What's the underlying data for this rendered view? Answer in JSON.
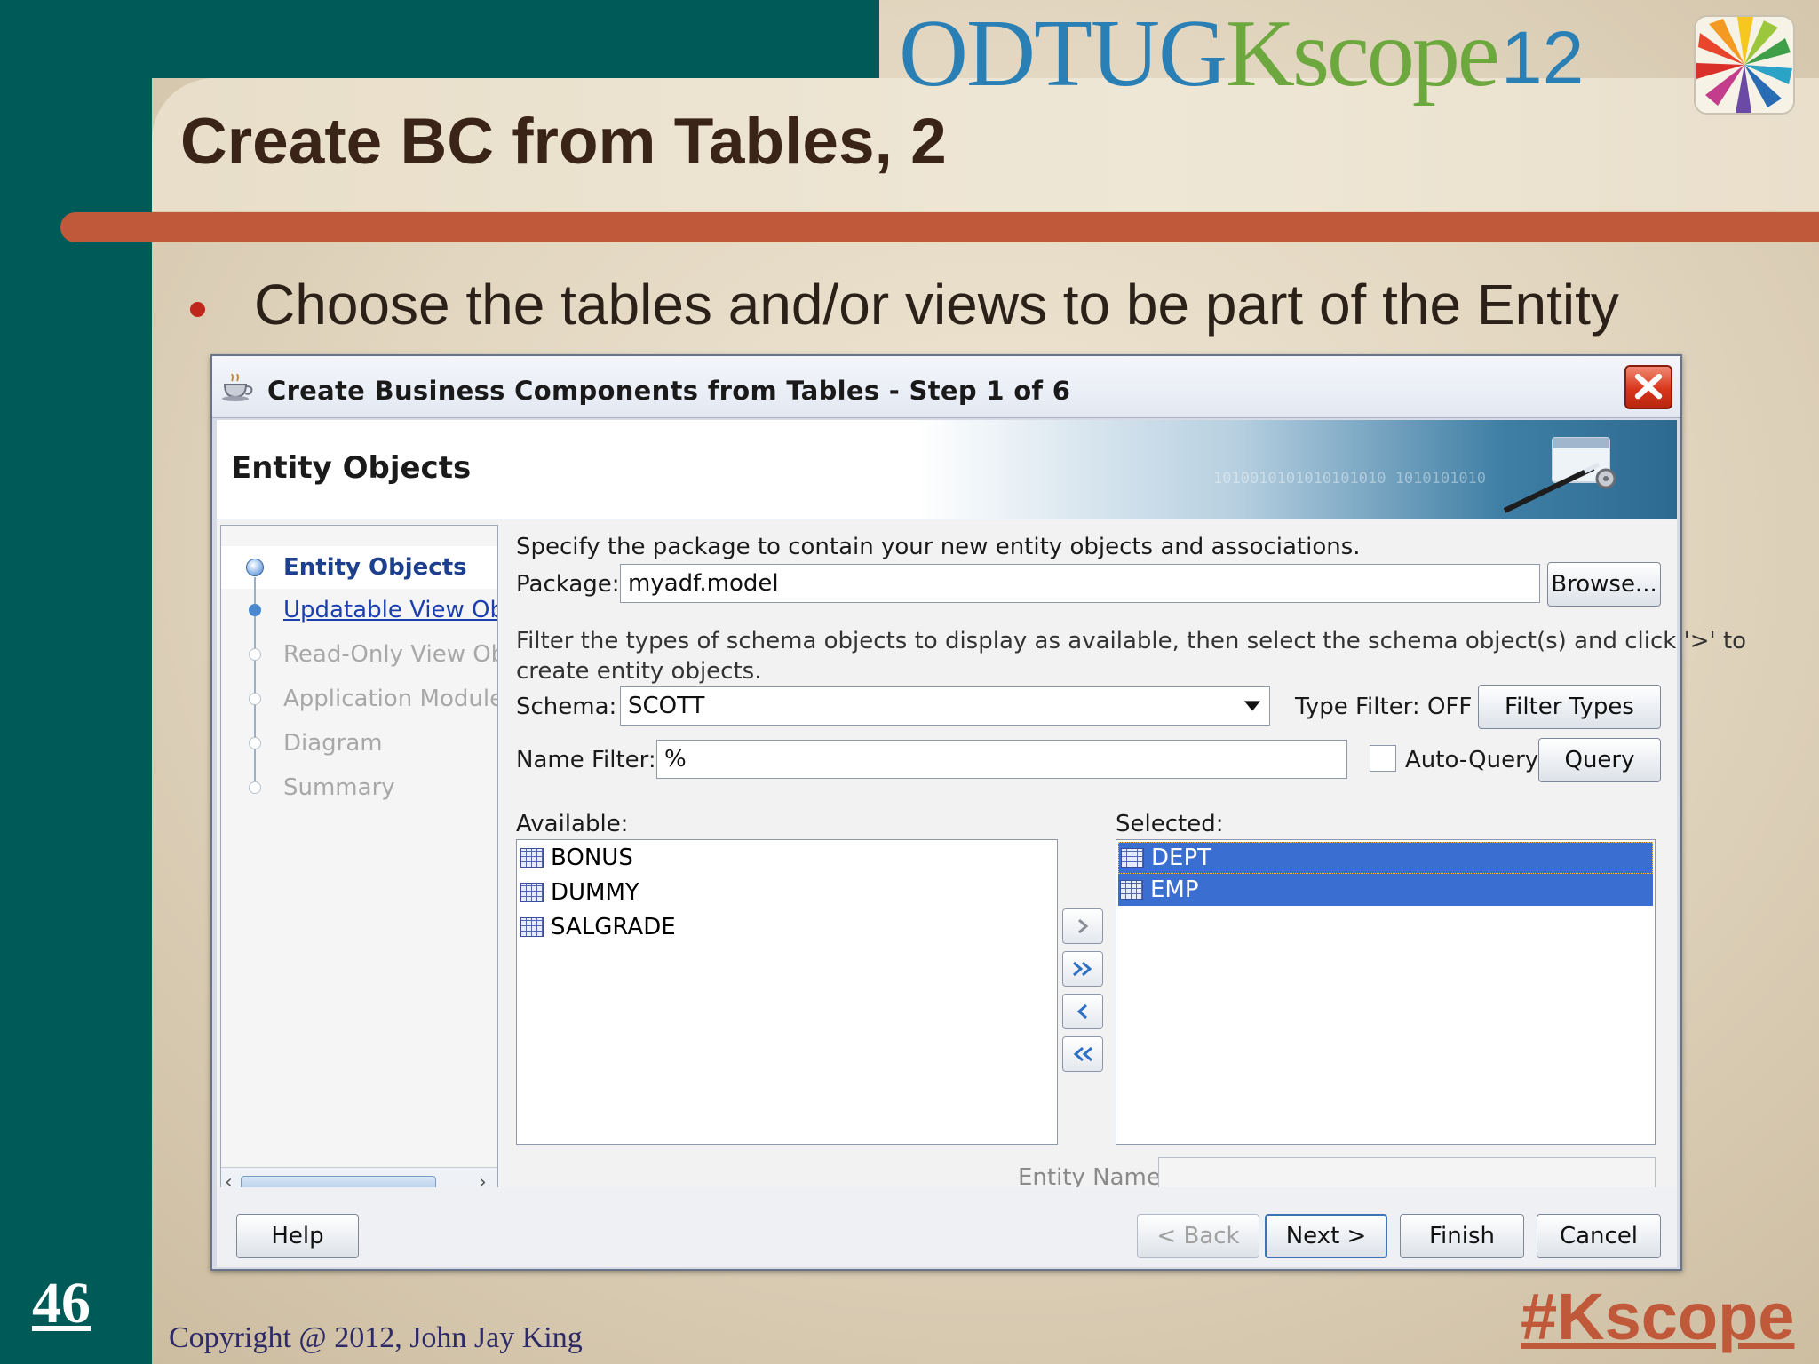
{
  "slide": {
    "title": "Create BC from Tables, 2",
    "bullet": "Choose the tables and/or views to be part of the Entity",
    "page_number": "46",
    "copyright": "Copyright @ 2012, John Jay King",
    "hashtag": "#Kscope",
    "logo": {
      "odtug": "ODTUG",
      "kscope": "Kscope",
      "year": "12"
    },
    "colors": {
      "band": "#005a58",
      "rule": "#c0583a",
      "title": "#3a2417",
      "bullet_dot": "#c0261b"
    }
  },
  "dialog": {
    "title": "Create Business Components from Tables - Step 1 of 6",
    "header_title": "Entity Objects",
    "header_binary": "1010010101010101010 1010101010",
    "nav": {
      "items": [
        {
          "label": "Entity Objects",
          "state": "current"
        },
        {
          "label": "Updatable View Obj",
          "state": "link"
        },
        {
          "label": "Read-Only View Obj",
          "state": "disabled"
        },
        {
          "label": "Application Module",
          "state": "disabled"
        },
        {
          "label": "Diagram",
          "state": "disabled"
        },
        {
          "label": "Summary",
          "state": "disabled"
        }
      ]
    },
    "package": {
      "intro": "Specify the package to contain your new entity objects and associations.",
      "label": "Package:",
      "value": "myadf.model",
      "browse_label": "Browse..."
    },
    "filter": {
      "intro_line1": "Filter the types of schema objects to display as available, then select the schema object(s) and click '>' to",
      "intro_line2": "create entity objects.",
      "schema_label": "Schema:",
      "schema_value": "SCOTT",
      "type_filter_label": "Type Filter: OFF",
      "filter_types_label": "Filter Types",
      "name_filter_label": "Name Filter:",
      "name_filter_value": "%",
      "auto_query_label": "Auto-Query",
      "auto_query_checked": false,
      "query_label": "Query"
    },
    "available": {
      "label": "Available:",
      "items": [
        "BONUS",
        "DUMMY",
        "SALGRADE"
      ]
    },
    "selected": {
      "label": "Selected:",
      "items": [
        "DEPT",
        "EMP"
      ]
    },
    "shuttle": {
      "add": "add-icon",
      "add_all": "add-all-icon",
      "remove": "remove-icon",
      "remove_all": "remove-all-icon"
    },
    "entity_name": {
      "label": "Entity Name:",
      "value": ""
    },
    "buttons": {
      "help": "Help",
      "back": "< Back",
      "next": "Next >",
      "finish": "Finish",
      "cancel": "Cancel"
    }
  }
}
